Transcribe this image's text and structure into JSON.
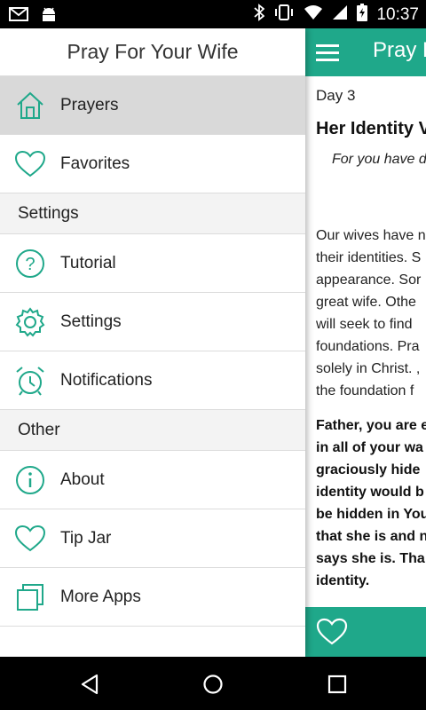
{
  "status_bar": {
    "time": "10:37"
  },
  "drawer": {
    "title": "Pray For Your Wife",
    "items_top": [
      {
        "label": "Prayers",
        "icon": "home-icon",
        "active": true
      },
      {
        "label": "Favorites",
        "icon": "heart-icon"
      }
    ],
    "section_settings": "Settings",
    "items_settings": [
      {
        "label": "Tutorial",
        "icon": "help-icon"
      },
      {
        "label": "Settings",
        "icon": "gear-icon"
      },
      {
        "label": "Notifications",
        "icon": "alarm-clock-icon"
      }
    ],
    "section_other": "Other",
    "items_other": [
      {
        "label": "About",
        "icon": "info-icon"
      },
      {
        "label": "Tip Jar",
        "icon": "heart-icon"
      },
      {
        "label": "More Apps",
        "icon": "stacked-squares-icon"
      }
    ]
  },
  "content": {
    "app_title": "Pray F",
    "day": "Day 3",
    "heading": "Her Identity V",
    "verse": "For you have d",
    "paragraph_lines": [
      "Our wives have n",
      "their identities. S",
      "appearance. Sor",
      "great wife. Othe",
      "will seek to find",
      "foundations. Pra",
      "solely in Christ. ,",
      "the foundation f"
    ],
    "prayer_lines": [
      "Father, you are e",
      "in all of your wa",
      "graciously hide",
      "identity would b",
      "be hidden in You",
      "that she is and n",
      "says she is. Tha",
      "identity."
    ]
  },
  "colors": {
    "accent": "#1fa88a",
    "active_row": "#d9d9d9",
    "icon_teal": "#1fa88a"
  }
}
